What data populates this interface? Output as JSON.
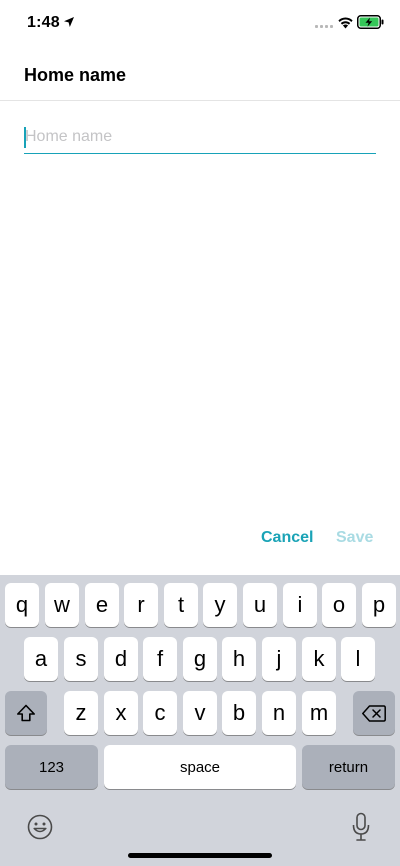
{
  "status_bar": {
    "time": "1:48"
  },
  "header": {
    "title": "Home name"
  },
  "form": {
    "home_name_value": "",
    "home_name_placeholder": "Home name"
  },
  "actions": {
    "cancel_label": "Cancel",
    "save_label": "Save"
  },
  "keyboard": {
    "row1": [
      "q",
      "w",
      "e",
      "r",
      "t",
      "y",
      "u",
      "i",
      "o",
      "p"
    ],
    "row2": [
      "a",
      "s",
      "d",
      "f",
      "g",
      "h",
      "j",
      "k",
      "l"
    ],
    "row3": [
      "z",
      "x",
      "c",
      "v",
      "b",
      "n",
      "m"
    ],
    "numbers_label": "123",
    "space_label": "space",
    "return_label": "return",
    "icons": [
      "shift-icon",
      "delete-icon",
      "emoji-icon",
      "microphone-icon"
    ]
  },
  "colors": {
    "accent": "#17a2b8",
    "save_disabled": "#a9dbe3",
    "keyboard_bg": "#d1d4db"
  }
}
